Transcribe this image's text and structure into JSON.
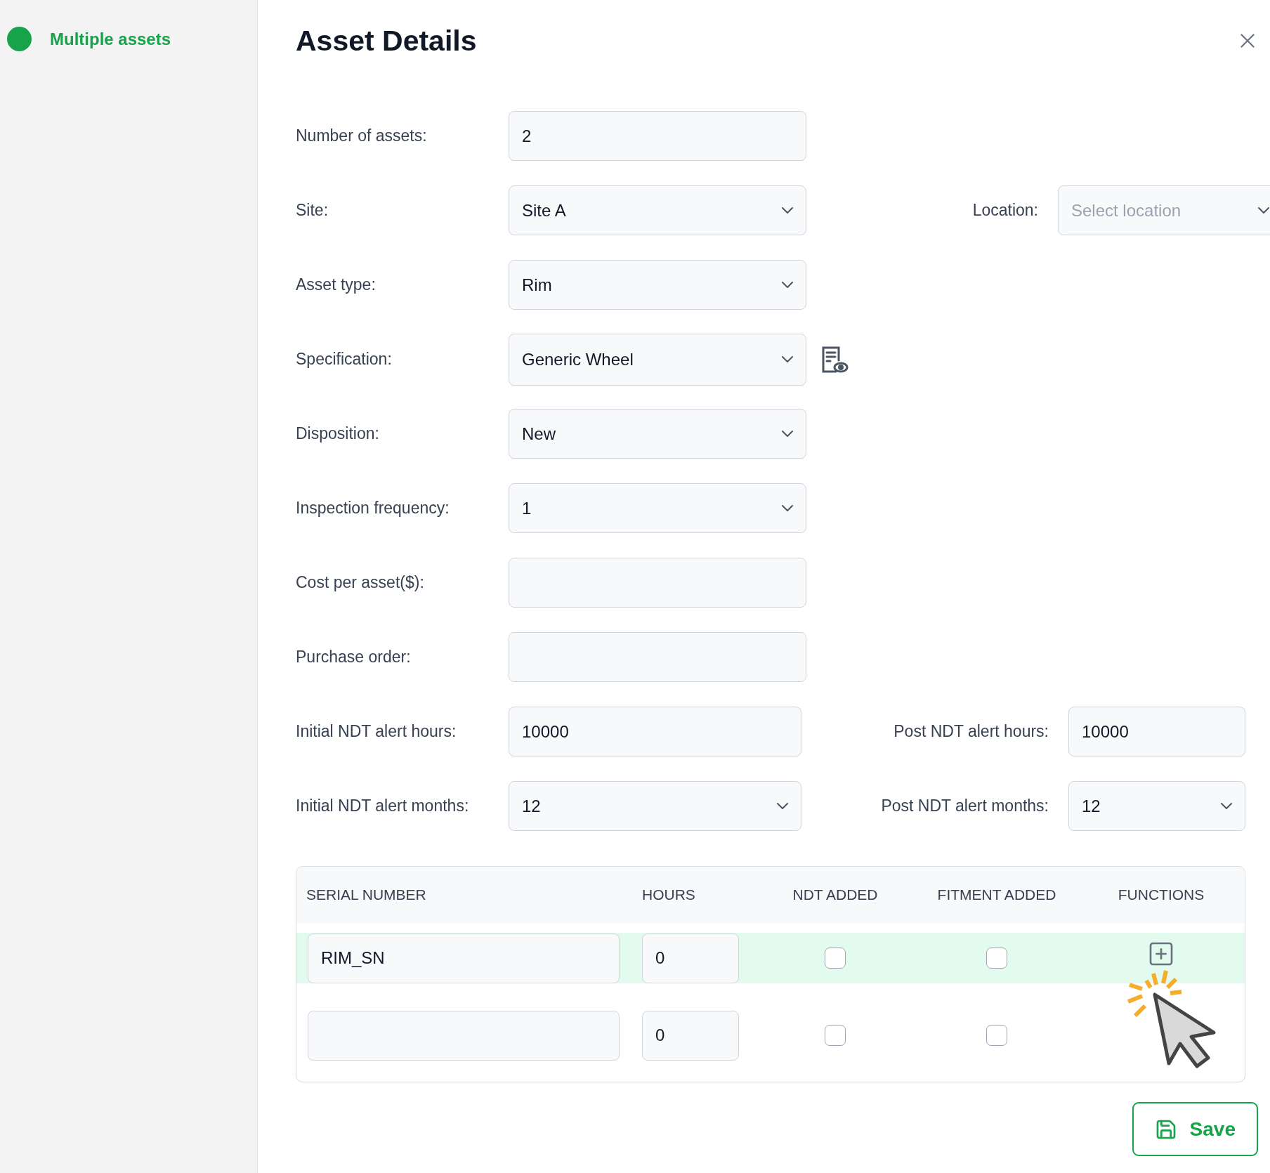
{
  "sidebar": {
    "items": [
      {
        "label": "Multiple assets",
        "color": "#16a34a"
      }
    ]
  },
  "title": "Asset Details",
  "form": {
    "rows": [
      {
        "fields": [
          {
            "label": "Number of assets:",
            "kind": "input",
            "value": "2"
          }
        ]
      },
      {
        "fields": [
          {
            "label": "Site:",
            "kind": "select",
            "value": "Site A"
          },
          {
            "label": "Location:",
            "kind": "select",
            "placeholder": "Select location"
          }
        ]
      },
      {
        "fields": [
          {
            "label": "Asset type:",
            "kind": "select",
            "value": "Rim"
          }
        ]
      },
      {
        "fields": [
          {
            "label": "Specification:",
            "kind": "select",
            "value": "Generic Wheel",
            "preview": true
          }
        ]
      },
      {
        "fields": [
          {
            "label": "Disposition:",
            "kind": "select",
            "value": "New"
          }
        ]
      },
      {
        "fields": [
          {
            "label": "Inspection frequency:",
            "kind": "select",
            "value": "1"
          }
        ]
      },
      {
        "fields": [
          {
            "label": "Cost per asset($):",
            "kind": "input"
          }
        ]
      },
      {
        "fields": [
          {
            "label": "Purchase order:",
            "kind": "input"
          }
        ]
      },
      {
        "fields": [
          {
            "label": "Initial NDT alert hours:",
            "kind": "input",
            "value": "10000"
          },
          {
            "label": "Post NDT alert hours:",
            "kind": "input",
            "value": "10000"
          }
        ]
      },
      {
        "fields": [
          {
            "label": "Initial NDT alert months:",
            "kind": "select",
            "value": "12"
          },
          {
            "label": "Post NDT alert months:",
            "kind": "select",
            "value": "12"
          }
        ]
      }
    ]
  },
  "table": {
    "columns": [
      "SERIAL NUMBER",
      "HOURS",
      "NDT ADDED",
      "FITMENT ADDED",
      "FUNCTIONS"
    ],
    "rows": [
      {
        "serial_number": "RIM_SN",
        "hours": "0",
        "ndt_added": false,
        "fitment_added": false,
        "selected": true,
        "add_action": true
      },
      {
        "hours": "0",
        "ndt_added": false,
        "fitment_added": false,
        "selected": false,
        "add_action": false
      }
    ]
  },
  "save_button": {
    "label": "Save"
  }
}
